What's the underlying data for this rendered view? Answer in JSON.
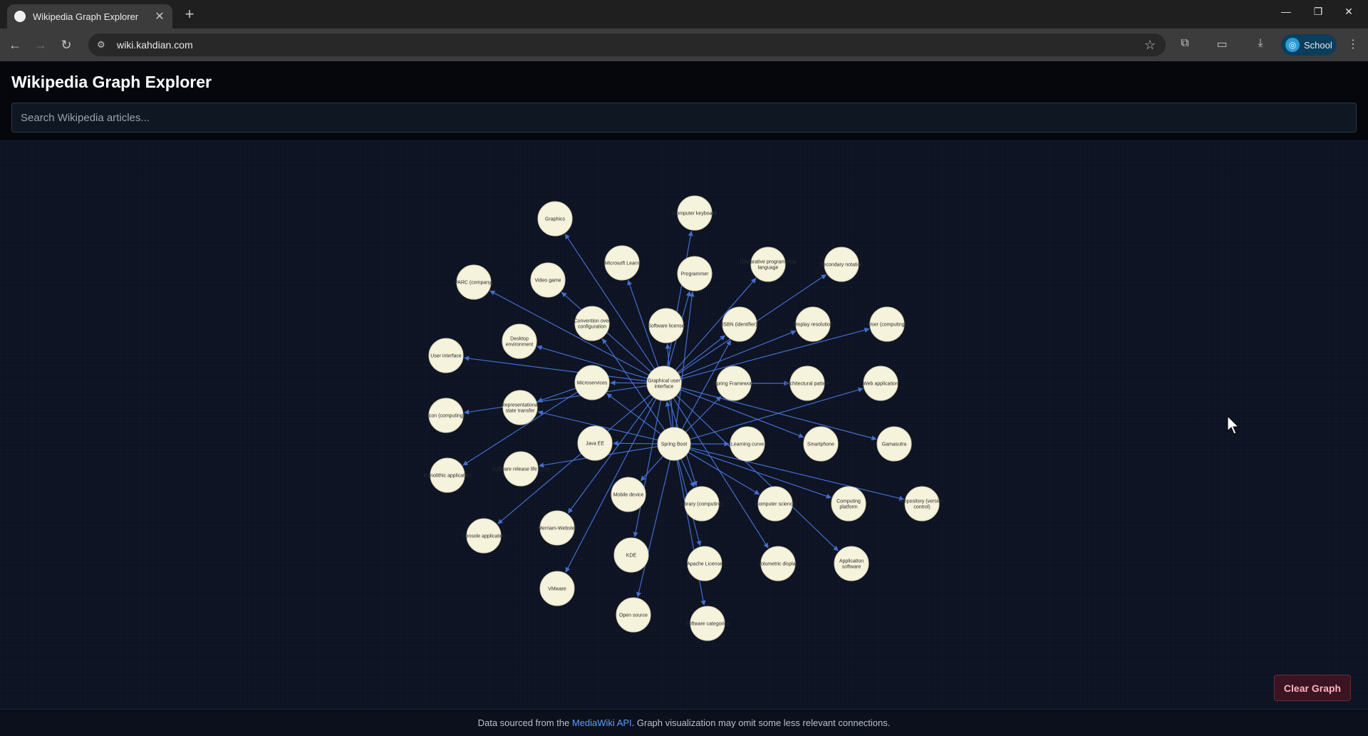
{
  "browser": {
    "tab_title": "Wikipedia Graph Explorer",
    "url": "wiki.kahdian.com",
    "profile_label": "School"
  },
  "app": {
    "title": "Wikipedia Graph Explorer",
    "search_placeholder": "Search Wikipedia articles...",
    "clear_button": "Clear Graph"
  },
  "footer": {
    "prefix": "Data sourced from the ",
    "link": "MediaWiki API",
    "suffix": ". Graph visualization may omit some less relevant connections."
  },
  "graph": {
    "nodes": [
      {
        "id": "gui",
        "label": [
          "Graphical user",
          "interface"
        ]
      },
      {
        "id": "springboot",
        "label": [
          "Spring Boot"
        ]
      },
      {
        "id": "microservices",
        "label": [
          "Microservices"
        ]
      },
      {
        "id": "springframework",
        "label": [
          "Spring Framework"
        ]
      },
      {
        "id": "graphics",
        "label": [
          "Graphics"
        ]
      },
      {
        "id": "keyboard",
        "label": [
          "Computer keyboard"
        ]
      },
      {
        "id": "mslearn",
        "label": [
          "Microsoft Learn"
        ]
      },
      {
        "id": "programmer",
        "label": [
          "Programmer"
        ]
      },
      {
        "id": "declarative",
        "label": [
          "Declarative programming",
          "language"
        ]
      },
      {
        "id": "secondary",
        "label": [
          "Secondary notation"
        ]
      },
      {
        "id": "parc",
        "label": [
          "PARC (company)"
        ]
      },
      {
        "id": "videogame",
        "label": [
          "Video game"
        ]
      },
      {
        "id": "convention",
        "label": [
          "Convention over",
          "configuration"
        ]
      },
      {
        "id": "license",
        "label": [
          "Software license"
        ]
      },
      {
        "id": "isbn",
        "label": [
          "ISBN (identifier)"
        ]
      },
      {
        "id": "resolution",
        "label": [
          "Display resolution"
        ]
      },
      {
        "id": "usercomp",
        "label": [
          "User (computing)"
        ]
      },
      {
        "id": "desktop",
        "label": [
          "Desktop",
          "environment"
        ]
      },
      {
        "id": "ui",
        "label": [
          "User interface"
        ]
      },
      {
        "id": "architectural",
        "label": [
          "Architectural pattern"
        ]
      },
      {
        "id": "webapp",
        "label": [
          "Web application"
        ]
      },
      {
        "id": "icon",
        "label": [
          "Icon (computing)"
        ]
      },
      {
        "id": "rest",
        "label": [
          "Representational",
          "state transfer"
        ]
      },
      {
        "id": "javaee",
        "label": [
          "Java EE"
        ]
      },
      {
        "id": "learning",
        "label": [
          "Learning curve"
        ]
      },
      {
        "id": "smartphone",
        "label": [
          "Smartphone"
        ]
      },
      {
        "id": "gamasutra",
        "label": [
          "Gamasutra"
        ]
      },
      {
        "id": "monolithic",
        "label": [
          "Monolithic application"
        ]
      },
      {
        "id": "lifecycle",
        "label": [
          "Software release life cycle"
        ]
      },
      {
        "id": "mobile",
        "label": [
          "Mobile device"
        ]
      },
      {
        "id": "library",
        "label": [
          "Library (computing)"
        ]
      },
      {
        "id": "compsci",
        "label": [
          "Computer science"
        ]
      },
      {
        "id": "platform",
        "label": [
          "Computing",
          "platform"
        ]
      },
      {
        "id": "repository",
        "label": [
          "Repository (version",
          "control)"
        ]
      },
      {
        "id": "console",
        "label": [
          "Console application"
        ]
      },
      {
        "id": "merriam",
        "label": [
          "Merriam-Webster"
        ]
      },
      {
        "id": "kde",
        "label": [
          "KDE"
        ]
      },
      {
        "id": "apache",
        "label": [
          "Apache License"
        ]
      },
      {
        "id": "volumetric",
        "label": [
          "Volumetric display"
        ]
      },
      {
        "id": "appsoft",
        "label": [
          "Application",
          "software"
        ]
      },
      {
        "id": "vmware",
        "label": [
          "VMware"
        ]
      },
      {
        "id": "opensource",
        "label": [
          "Open source"
        ]
      },
      {
        "id": "softcat",
        "label": [
          "Software categories"
        ]
      }
    ],
    "edges": [
      [
        "gui",
        "graphics"
      ],
      [
        "gui",
        "keyboard"
      ],
      [
        "gui",
        "mslearn"
      ],
      [
        "gui",
        "programmer"
      ],
      [
        "gui",
        "declarative"
      ],
      [
        "gui",
        "secondary"
      ],
      [
        "gui",
        "parc"
      ],
      [
        "gui",
        "videogame"
      ],
      [
        "gui",
        "isbn"
      ],
      [
        "gui",
        "resolution"
      ],
      [
        "gui",
        "usercomp"
      ],
      [
        "gui",
        "desktop"
      ],
      [
        "gui",
        "ui"
      ],
      [
        "gui",
        "icon"
      ],
      [
        "gui",
        "smartphone"
      ],
      [
        "gui",
        "gamasutra"
      ],
      [
        "gui",
        "volumetric"
      ],
      [
        "gui",
        "appsoft"
      ],
      [
        "gui",
        "console"
      ],
      [
        "gui",
        "vmware"
      ],
      [
        "gui",
        "kde"
      ],
      [
        "gui",
        "library"
      ],
      [
        "gui",
        "merriam"
      ],
      [
        "gui",
        "microservices"
      ],
      [
        "springboot",
        "convention"
      ],
      [
        "springboot",
        "license"
      ],
      [
        "springboot",
        "isbn"
      ],
      [
        "springboot",
        "springframework"
      ],
      [
        "springboot",
        "microservices"
      ],
      [
        "springboot",
        "javaee"
      ],
      [
        "springboot",
        "learning"
      ],
      [
        "springboot",
        "webapp"
      ],
      [
        "springboot",
        "lifecycle"
      ],
      [
        "springboot",
        "mobile"
      ],
      [
        "springboot",
        "library"
      ],
      [
        "springboot",
        "compsci"
      ],
      [
        "springboot",
        "platform"
      ],
      [
        "springboot",
        "repository"
      ],
      [
        "springboot",
        "apache"
      ],
      [
        "springboot",
        "opensource"
      ],
      [
        "springboot",
        "softcat"
      ],
      [
        "springboot",
        "rest"
      ],
      [
        "springboot",
        "programmer"
      ],
      [
        "springboot",
        "gui"
      ],
      [
        "microservices",
        "monolithic"
      ],
      [
        "microservices",
        "rest"
      ],
      [
        "springframework",
        "architectural"
      ]
    ]
  }
}
